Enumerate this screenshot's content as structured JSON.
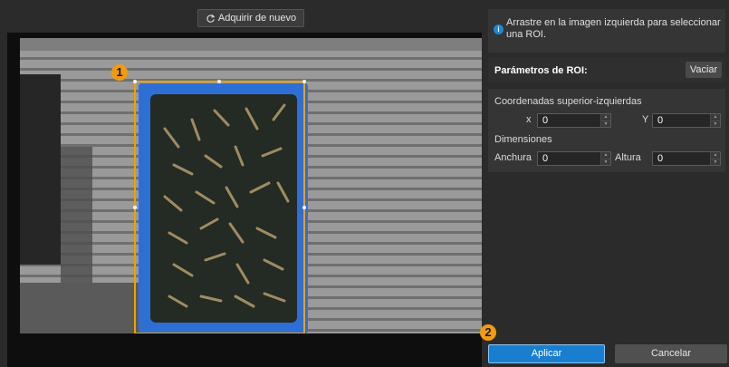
{
  "toolbar": {
    "reacquire_label": "Adquirir de nuevo",
    "reacquire_icon": "refresh-icon"
  },
  "hint": {
    "icon": "info-icon",
    "icon_glyph": "i",
    "text": "Arrastre en la imagen izquierda para seleccionar una ROI."
  },
  "roi": {
    "title": "Parámetros de ROI:",
    "clear_label": "Vaciar",
    "top_left_label": "Coordenadas superior-izquierdas",
    "x_label": "x",
    "x_value": "0",
    "y_label": "Y",
    "y_value": "0",
    "dimensions_label": "Dimensiones",
    "width_label": "Anchura",
    "width_value": "0",
    "height_label": "Altura",
    "height_value": "0"
  },
  "actions": {
    "apply_label": "Aplicar",
    "cancel_label": "Cancelar"
  },
  "callouts": {
    "one": "1",
    "two": "2"
  },
  "colors": {
    "accent": "#1a7ed0",
    "callout": "#f29b12",
    "selection": "#f0a000",
    "tray": "#2e6fd6"
  }
}
